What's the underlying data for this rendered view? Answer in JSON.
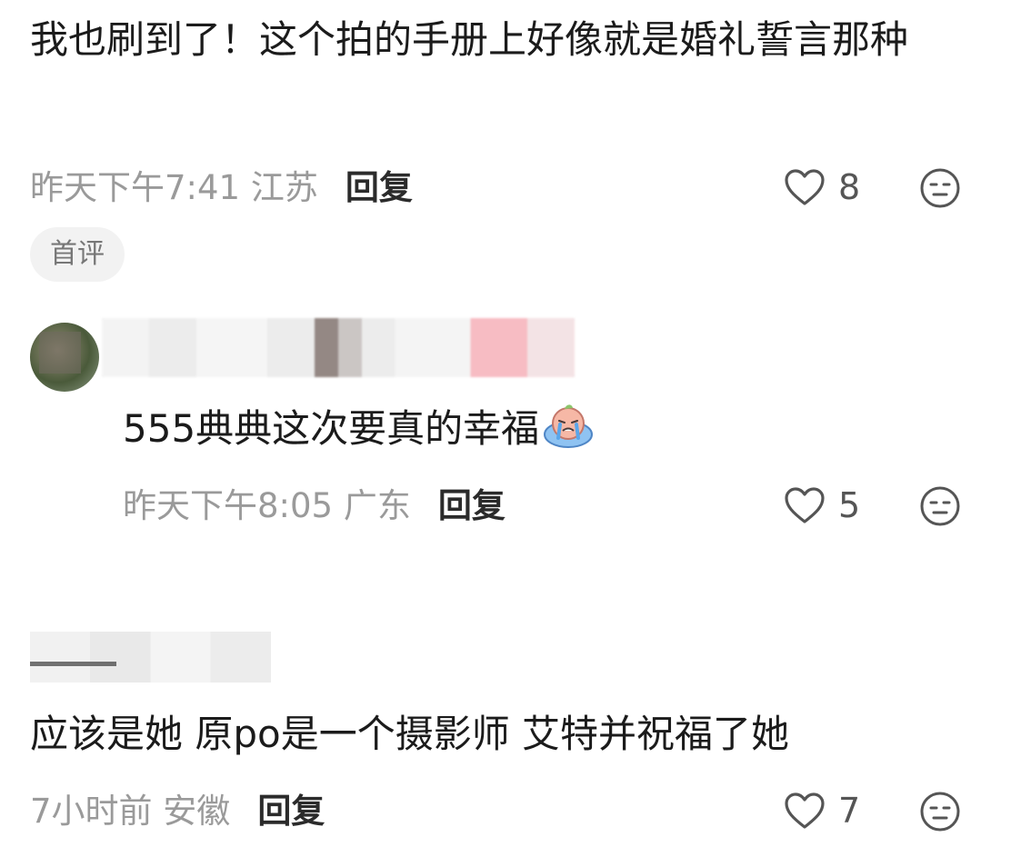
{
  "comments": [
    {
      "text": "我也刷到了！这个拍的手册上好像就是婚礼誓言那种",
      "time_location": "昨天下午7:41 江苏",
      "reply_label": "回复",
      "likes": "8",
      "badge": "首评"
    },
    {
      "text": "555典典这次要真的幸福",
      "emoji": "crying-face-emoji",
      "time_location": "昨天下午8:05 广东",
      "reply_label": "回复",
      "likes": "5"
    },
    {
      "text": "应该是她 原po是一个摄影师 艾特并祝福了她",
      "time_location": "7小时前 安徽",
      "reply_label": "回复",
      "likes": "7"
    }
  ],
  "icons": {
    "like": "heart-outline-icon",
    "emoji_reaction": "neutral-face-icon"
  },
  "colors": {
    "text": "#1b1b1b",
    "meta": "#9a9a9a",
    "badge_bg": "#f2f2f2"
  }
}
